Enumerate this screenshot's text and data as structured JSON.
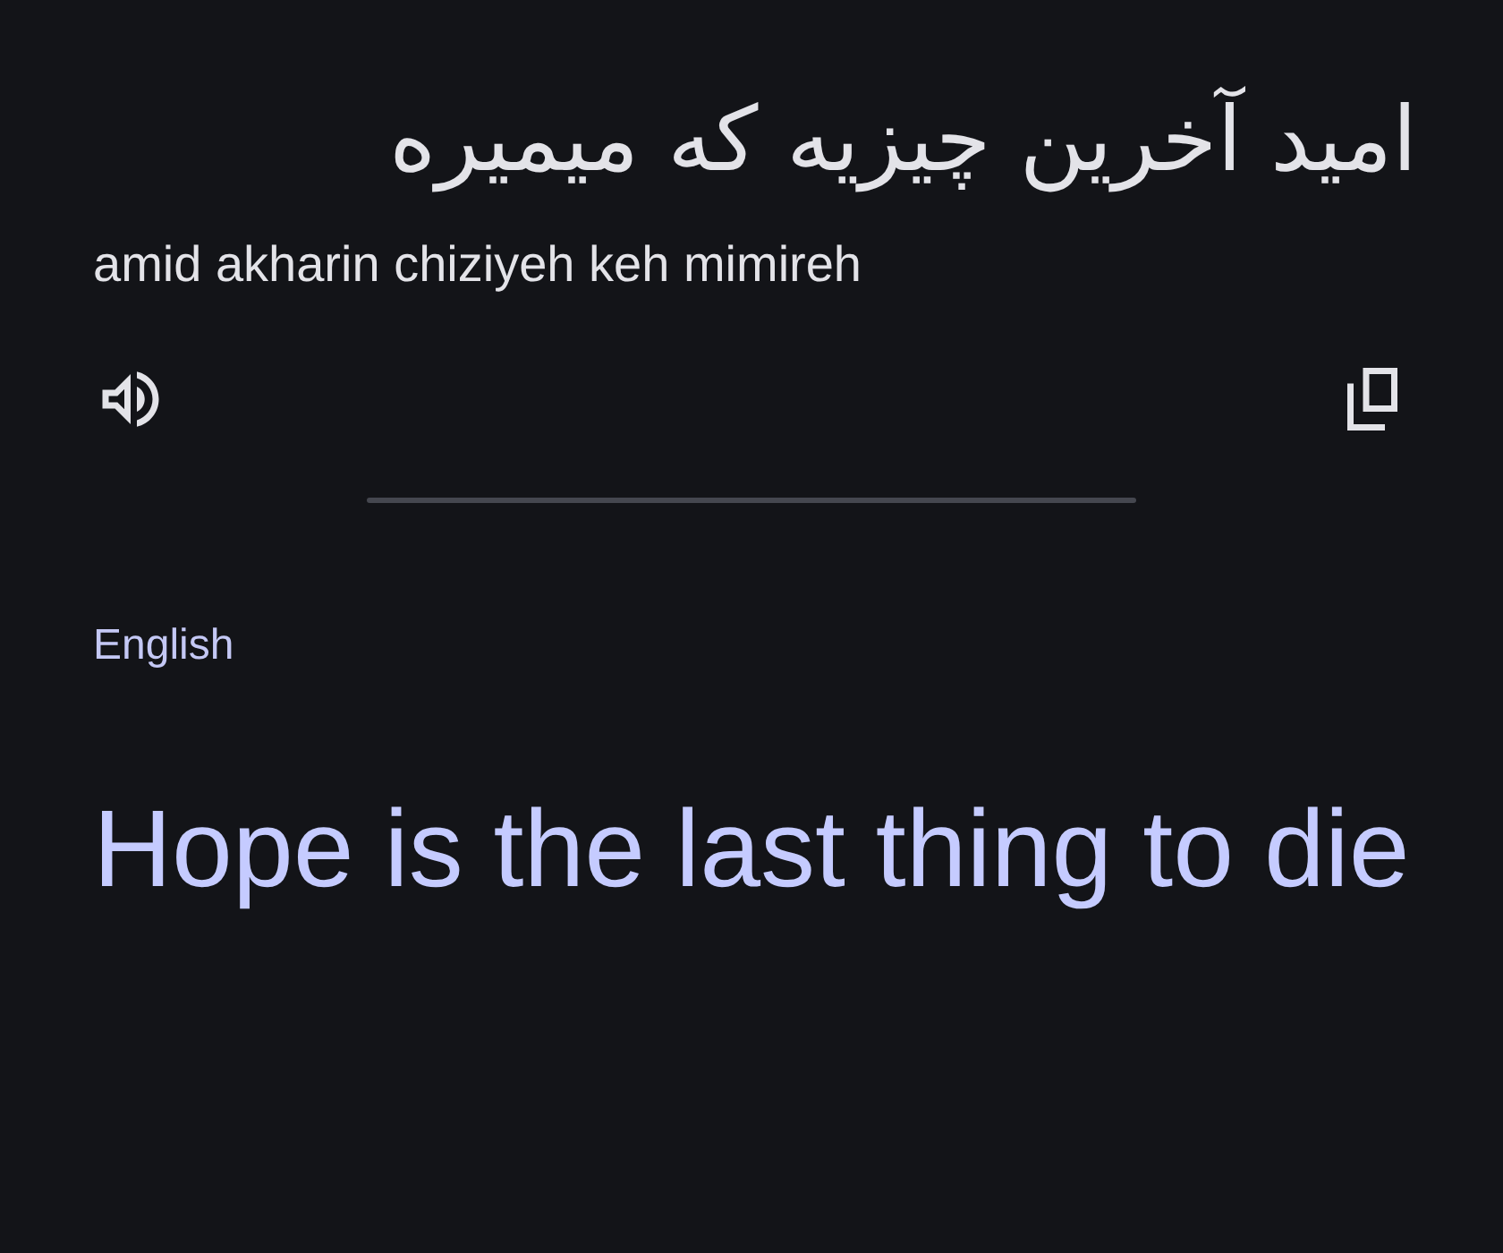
{
  "source": {
    "text": "امید آخرین چیزیه که میمیره",
    "transliteration": "amid akharin chiziyeh keh mimireh"
  },
  "target": {
    "language": "English",
    "text": "Hope is the last thing to die"
  }
}
